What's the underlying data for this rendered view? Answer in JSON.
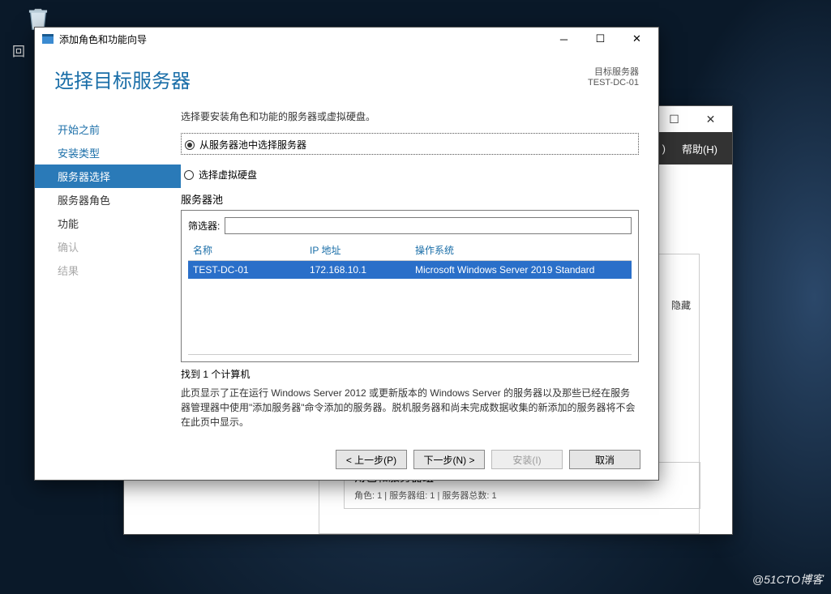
{
  "desktop": {
    "recycle_bin": "回收站"
  },
  "watermark": "@51CTO博客",
  "back_window": {
    "menu_split": ")",
    "menu_help": "帮助(H)",
    "panel_hide": "隐藏",
    "role_title": "角色和服务器组",
    "role_sub": "角色: 1 | 服务器组: 1 | 服务器总数: 1"
  },
  "wizard": {
    "title": "添加角色和功能向导",
    "heading": "选择目标服务器",
    "head_right_l1": "目标服务器",
    "head_right_l2": "TEST-DC-01",
    "nav": {
      "before": "开始之前",
      "install_type": "安装类型",
      "server_select": "服务器选择",
      "server_roles": "服务器角色",
      "features": "功能",
      "confirm": "确认",
      "results": "结果"
    },
    "content": {
      "instruction": "选择要安装角色和功能的服务器或虚拟硬盘。",
      "radio_pool": "从服务器池中选择服务器",
      "radio_vhd": "选择虚拟硬盘",
      "pool_label": "服务器池",
      "filter_label": "筛选器:",
      "filter_value": "",
      "col_name": "名称",
      "col_ip": "IP 地址",
      "col_os": "操作系统",
      "row": {
        "name": "TEST-DC-01",
        "ip": "172.168.10.1",
        "os": "Microsoft Windows Server 2019 Standard"
      },
      "found": "找到 1 个计算机",
      "note": "此页显示了正在运行 Windows Server 2012 或更新版本的 Windows Server 的服务器以及那些已经在服务器管理器中使用\"添加服务器\"命令添加的服务器。脱机服务器和尚未完成数据收集的新添加的服务器将不会在此页中显示。"
    },
    "footer": {
      "prev": "< 上一步(P)",
      "next": "下一步(N) >",
      "install": "安装(I)",
      "cancel": "取消"
    }
  }
}
